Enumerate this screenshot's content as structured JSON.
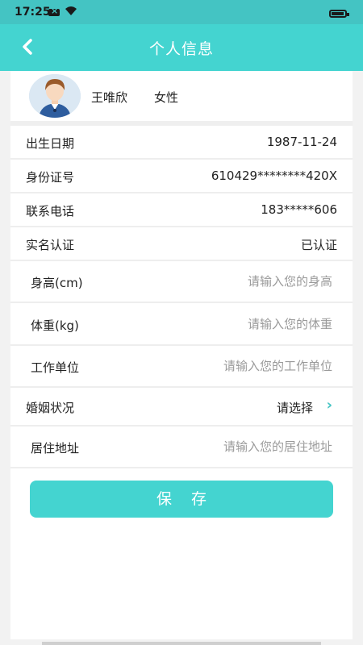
{
  "status_bar": {
    "time": "17:25",
    "icons": [
      "sim-icon",
      "wifi-icon",
      "battery-icon"
    ]
  },
  "header": {
    "title": "个人信息",
    "back_icon": "chevron-left-icon"
  },
  "profile": {
    "name": "王唯欣",
    "gender": "女性"
  },
  "info_rows": [
    {
      "label": "出生日期",
      "value": "1987-11-24"
    },
    {
      "label": "身份证号",
      "value": "610429********420X"
    },
    {
      "label": "联系电话",
      "value": "183*****606"
    },
    {
      "label": "实名认证",
      "value": "已认证"
    }
  ],
  "input_rows": [
    {
      "label": "身高(cm)",
      "placeholder": "请输入您的身高"
    },
    {
      "label": "体重(kg)",
      "placeholder": "请输入您的体重"
    },
    {
      "label": "工作单位",
      "placeholder": "请输入您的工作单位"
    }
  ],
  "marital": {
    "label": "婚姻状况",
    "value": "请选择",
    "icon": "chevron-right-icon"
  },
  "address": {
    "label": "居住地址",
    "placeholder": "请输入您的居住地址"
  },
  "save_button": {
    "label": "保存"
  },
  "colors": {
    "accent": "#44d4d0",
    "status_bar": "#44c4c3",
    "placeholder": "#9a9a9a"
  }
}
